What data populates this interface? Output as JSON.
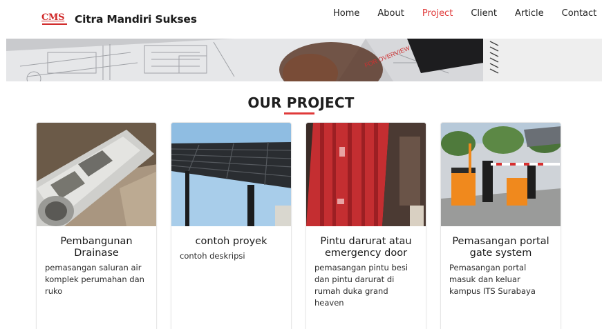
{
  "brand": {
    "logo_text": "CMS",
    "name": "Citra Mandiri Sukses"
  },
  "nav": {
    "items": [
      {
        "label": "Home",
        "active": false
      },
      {
        "label": "About",
        "active": false
      },
      {
        "label": "Project",
        "active": true
      },
      {
        "label": "Client",
        "active": false
      },
      {
        "label": "Article",
        "active": false
      },
      {
        "label": "Contact",
        "active": false
      }
    ]
  },
  "hero": {
    "overlay_text": "FOR OVERVIEW"
  },
  "section": {
    "title": "OUR PROJECT"
  },
  "projects": [
    {
      "title": "Pembangunan Drainase",
      "description": "pemasangan saluran air komplek perumahan dan ruko"
    },
    {
      "title": "contoh proyek",
      "description": "contoh deskripsi"
    },
    {
      "title": "Pintu darurat atau emergency door",
      "description": "pemasangan pintu besi dan pintu darurat di rumah duka grand heaven"
    },
    {
      "title": "Pemasangan portal gate system",
      "description": "Pemasangan portal masuk dan keluar kampus ITS Surabaya"
    }
  ],
  "colors": {
    "accent": "#e03a3a",
    "text": "#222222",
    "brand_red": "#d02828"
  }
}
